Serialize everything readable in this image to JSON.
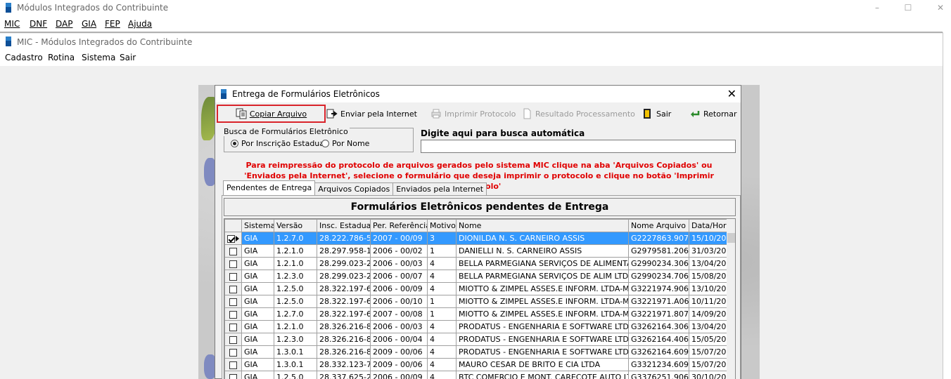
{
  "outer_window": {
    "title": "Módulos Integrados do Contribuinte",
    "menu": [
      "MIC",
      "DNF",
      "DAP",
      "GIA",
      "FEP",
      "Ajuda"
    ],
    "controls": [
      "–",
      "☐",
      "✕"
    ]
  },
  "mdi_window": {
    "title": "MIC - Módulos Integrados do Contribuinte",
    "menu": [
      "Cadastro",
      "Rotina",
      "Sistema",
      "Sair"
    ]
  },
  "dialog": {
    "title": "Entrega de Formulários Eletrônicos",
    "close": "✕",
    "toolbar": {
      "copiar": "Copiar Arquivo",
      "enviar": "Enviar pela Internet",
      "imprimir": "Imprimir Protocolo",
      "resultado": "Resultado Processamento",
      "sair": "Sair",
      "retornar": "Retornar"
    },
    "search": {
      "group_label": "Busca de Formulários Eletrônico",
      "opt_inscricao": "Por Inscrição Estadual",
      "opt_nome": "Por Nome",
      "selected": "Por Inscrição Estadual",
      "auto_label": "Digite aqui para busca automática",
      "auto_value": ""
    },
    "notice_line1": "Para reimpressão do protocolo de arquivos gerados pelo sistema MIC clique na aba 'Arquivos Copiados' ou",
    "notice_line2": "'Enviados pela Internet', selecione o formulário que deseja imprimir o protocolo e clique no botão 'Imprimir Protocolo'",
    "tabs": [
      "Pendentes de Entrega",
      "Arquivos Copiados",
      "Enviados pela Internet"
    ],
    "active_tab": "Pendentes de Entrega",
    "grid_title": "Formulários Eletrônicos pendentes de Entrega",
    "columns": [
      "Sistema",
      "Versão",
      "Insc. Estadual",
      "Per. Referência",
      "Motivo",
      "Nome",
      "Nome Arquivo",
      "Data/Hor"
    ],
    "rows": [
      {
        "checked": true,
        "selected": true,
        "sistema": "GIA",
        "versao": "1.2.7.0",
        "insc": "28.222.786-5",
        "per": "2007 - 00/09",
        "motivo": "3",
        "nome": "DIONILDA N. S. CARNEIRO ASSIS",
        "arquivo": "G2227863.907",
        "data": "15/10/20"
      },
      {
        "checked": false,
        "selected": false,
        "sistema": "GIA",
        "versao": "1.2.1.0",
        "insc": "28.297.958-1",
        "per": "2006 - 00/02",
        "motivo": "1",
        "nome": "DANIELLI  N. S. CARNEIRO ASSIS",
        "arquivo": "G2979581.206",
        "data": "31/03/20"
      },
      {
        "checked": false,
        "selected": false,
        "sistema": "GIA",
        "versao": "1.2.1.0",
        "insc": "28.299.023-2",
        "per": "2006 - 00/03",
        "motivo": "4",
        "nome": "BELLA PARMEGIANA SERVIÇOS DE ALIMENTAÇ",
        "arquivo": "G2990234.306",
        "data": "13/04/20"
      },
      {
        "checked": false,
        "selected": false,
        "sistema": "GIA",
        "versao": "1.2.3.0",
        "insc": "28.299.023-2",
        "per": "2006 - 00/07",
        "motivo": "4",
        "nome": "BELLA PARMEGIANA SERVIÇOS DE ALIM LTDA",
        "arquivo": "G2990234.706",
        "data": "15/08/20"
      },
      {
        "checked": false,
        "selected": false,
        "sistema": "GIA",
        "versao": "1.2.5.0",
        "insc": "28.322.197-6",
        "per": "2006 - 00/09",
        "motivo": "4",
        "nome": "MIOTTO & ZIMPEL ASSES.E INFORM. LTDA-ME",
        "arquivo": "G3221974.906",
        "data": "13/10/20"
      },
      {
        "checked": false,
        "selected": false,
        "sistema": "GIA",
        "versao": "1.2.5.0",
        "insc": "28.322.197-6",
        "per": "2006 - 00/10",
        "motivo": "1",
        "nome": "MIOTTO & ZIMPEL ASSES.E INFORM. LTDA-ME",
        "arquivo": "G3221971.A06",
        "data": "10/11/20"
      },
      {
        "checked": false,
        "selected": false,
        "sistema": "GIA",
        "versao": "1.2.7.0",
        "insc": "28.322.197-6",
        "per": "2007 - 00/08",
        "motivo": "1",
        "nome": "MIOTTO & ZIMPEL ASSES.E INFORM. LTDA-ME",
        "arquivo": "G3221971.807",
        "data": "14/09/20"
      },
      {
        "checked": false,
        "selected": false,
        "sistema": "GIA",
        "versao": "1.2.1.0",
        "insc": "28.326.216-8",
        "per": "2006 - 00/03",
        "motivo": "4",
        "nome": "PRODATUS - ENGENHARIA E SOFTWARE LTDA",
        "arquivo": "G3262164.306",
        "data": "13/04/20"
      },
      {
        "checked": false,
        "selected": false,
        "sistema": "GIA",
        "versao": "1.2.3.0",
        "insc": "28.326.216-8",
        "per": "2006 - 00/04",
        "motivo": "4",
        "nome": "PRODATUS - ENGENHARIA E SOFTWARE LTDA",
        "arquivo": "G3262164.406",
        "data": "15/05/20"
      },
      {
        "checked": false,
        "selected": false,
        "sistema": "GIA",
        "versao": "1.3.0.1",
        "insc": "28.326.216-8",
        "per": "2009 - 00/06",
        "motivo": "4",
        "nome": "PRODATUS - ENGENHARIA E SOFTWARE LTDA",
        "arquivo": "G3262164.609",
        "data": "15/07/20"
      },
      {
        "checked": false,
        "selected": false,
        "sistema": "GIA",
        "versao": "1.3.0.1",
        "insc": "28.332.123-7",
        "per": "2009 - 00/06",
        "motivo": "4",
        "nome": "MAURO CESAR DE BRITO E CIA LTDA",
        "arquivo": "G3321234.609",
        "data": "15/07/20"
      },
      {
        "checked": false,
        "selected": false,
        "sistema": "GIA",
        "versao": "1.2.5.0",
        "insc": "28.337.625-2",
        "per": "2006 - 00/09",
        "motivo": "4",
        "nome": "BTC COMERCIO E MONT. CARECOTE AUTO LT",
        "arquivo": "G3376251.906",
        "data": "30/10/20"
      }
    ]
  },
  "colors": {
    "selected_row": "#3399ff",
    "notice": "#e00000",
    "highlight_box": "#d9232a"
  }
}
